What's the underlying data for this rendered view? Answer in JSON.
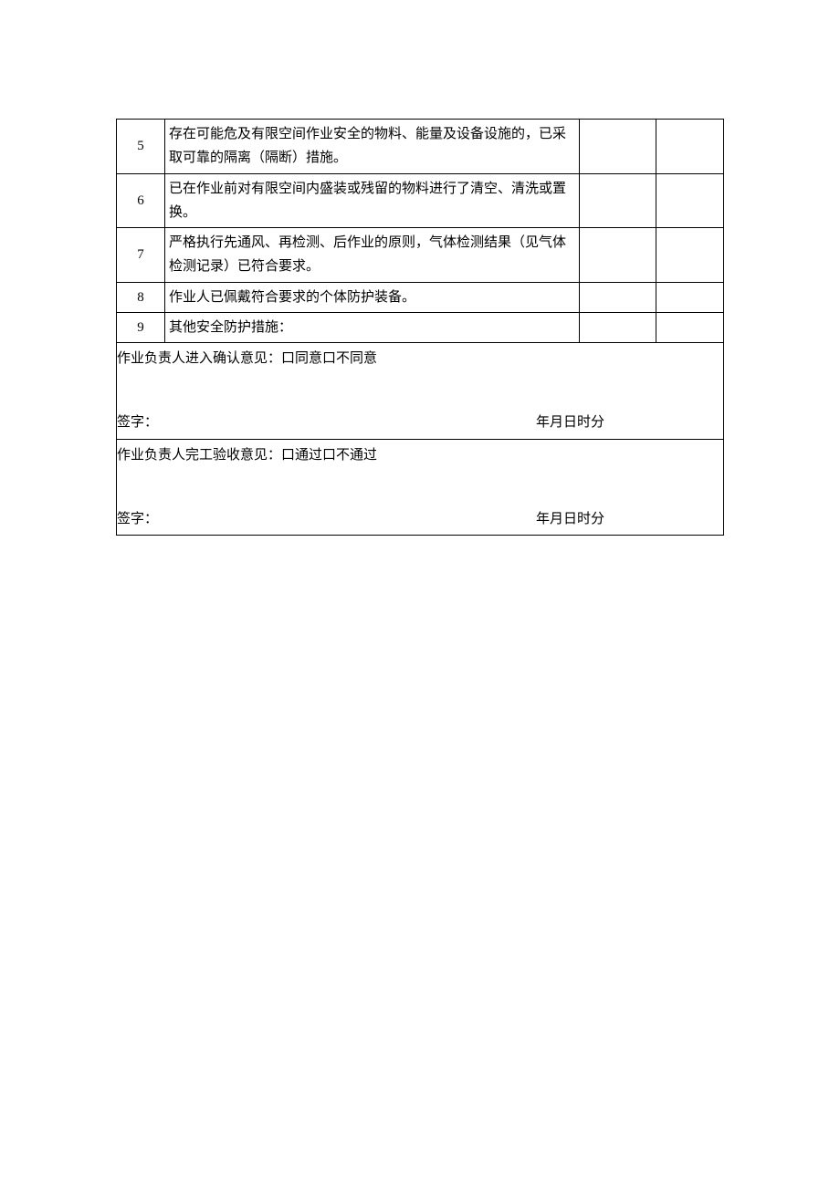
{
  "rows": [
    {
      "num": "5",
      "desc": "存在可能危及有限空间作业安全的物料、能量及设备设施的，已采取可靠的隔离（隔断）措施。"
    },
    {
      "num": "6",
      "desc": "已在作业前对有限空间内盛装或残留的物料进行了清空、清洗或置换。"
    },
    {
      "num": "7",
      "desc": "严格执行先通风、再检测、后作业的原则，气体检测结果（见气体检测记录）已符合要求。"
    },
    {
      "num": "8",
      "desc": "作业人已佩戴符合要求的个体防护装备。"
    },
    {
      "num": "9",
      "desc": "其他安全防护措施："
    }
  ],
  "confirmation": {
    "label": "作业负责人进入确认意见：",
    "option_agree": "口同意",
    "option_disagree": "口不同意",
    "sign_label": "签字：",
    "date_label": "年月日时分"
  },
  "acceptance": {
    "label": "作业负责人完工验收意见：",
    "option_pass": "口通过",
    "option_fail": "口不通过",
    "sign_label": "签字：",
    "date_label": "年月日时分"
  }
}
